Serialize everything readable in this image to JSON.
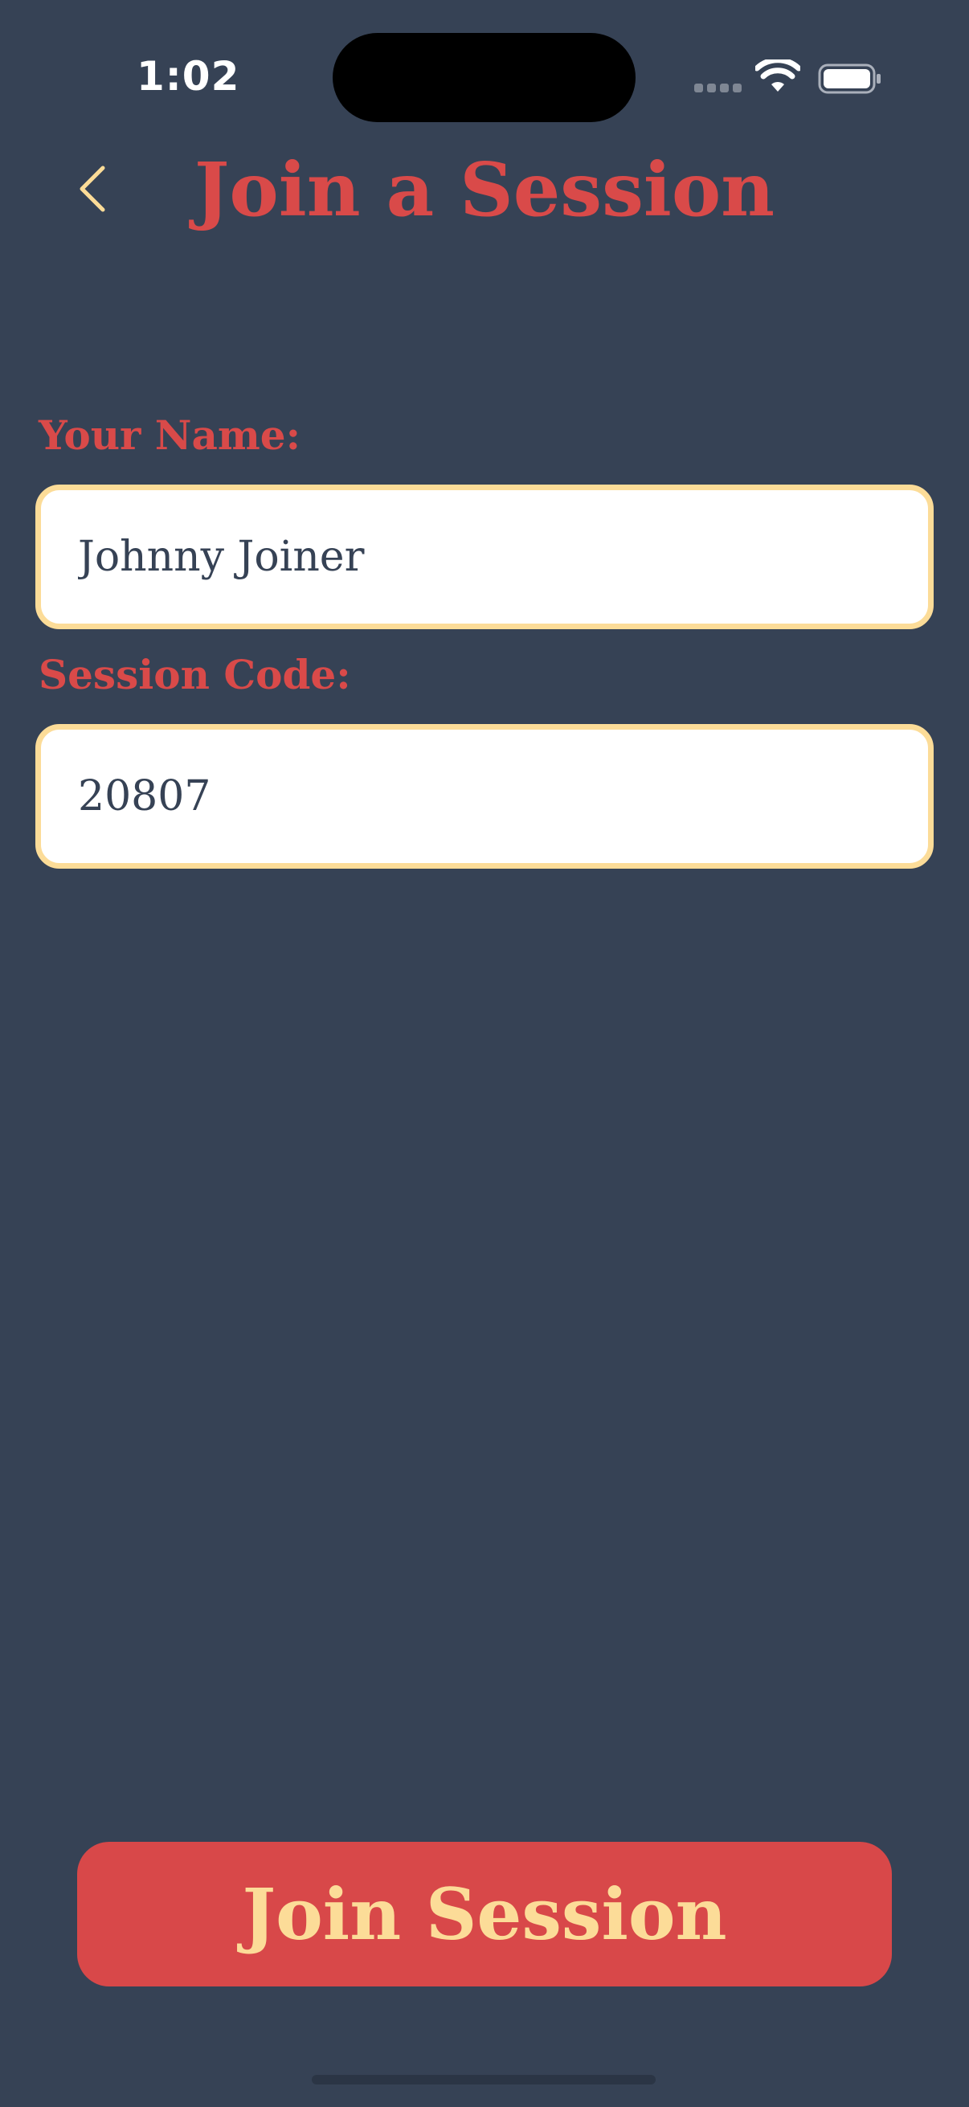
{
  "status_bar": {
    "time": "1:02"
  },
  "header": {
    "title": "Join a Session",
    "back_icon": "chevron-left-icon"
  },
  "form": {
    "name_label": "Your Name:",
    "name_value": "Johnny Joiner",
    "code_label": "Session Code:",
    "code_value": "20807"
  },
  "actions": {
    "join_label": "Join Session"
  },
  "colors": {
    "background": "#364255",
    "accent_red": "#d94a49",
    "accent_cream": "#fcdc98",
    "field_bg": "#ffffff"
  }
}
